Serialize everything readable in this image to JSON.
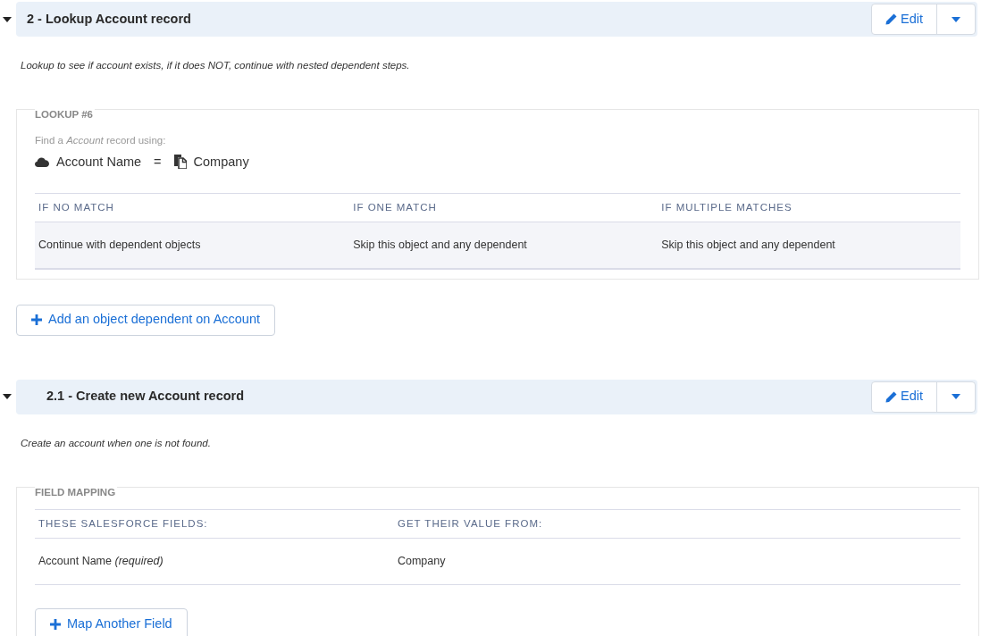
{
  "steps": [
    {
      "kind": "lookup",
      "title": "2 - Lookup Account record",
      "expanded": true,
      "edit_label": "Edit",
      "description": "Lookup to see if account exists, if it does NOT, continue with nested dependent steps.",
      "section": {
        "legend": "LOOKUP #6",
        "find_text": "Find a *Account* record using:",
        "condition": {
          "left": "Account Name",
          "operator": "=",
          "right": "Company"
        },
        "columns": [
          "IF NO MATCH",
          "IF ONE MATCH",
          "IF MULTIPLE MATCHES"
        ],
        "rows": [
          [
            "Continue with dependent objects",
            "Skip this object and any dependent",
            "Skip this object and any dependent"
          ]
        ]
      },
      "add_button": "Add an object dependent on Account",
      "children": [
        {
          "kind": "field_mapping",
          "title": "2.1 - Create new Account record",
          "expanded": true,
          "edit_label": "Edit",
          "description": "Create an account when one is not found.",
          "section": {
            "legend": "FIELD MAPPING",
            "columns": [
              "THESE SALESFORCE FIELDS:",
              "GET THEIR VALUE FROM:"
            ],
            "rows": [
              [
                "Account Name *(required)*",
                "Company"
              ]
            ]
          },
          "add_button": "Map Another Field"
        }
      ]
    }
  ]
}
